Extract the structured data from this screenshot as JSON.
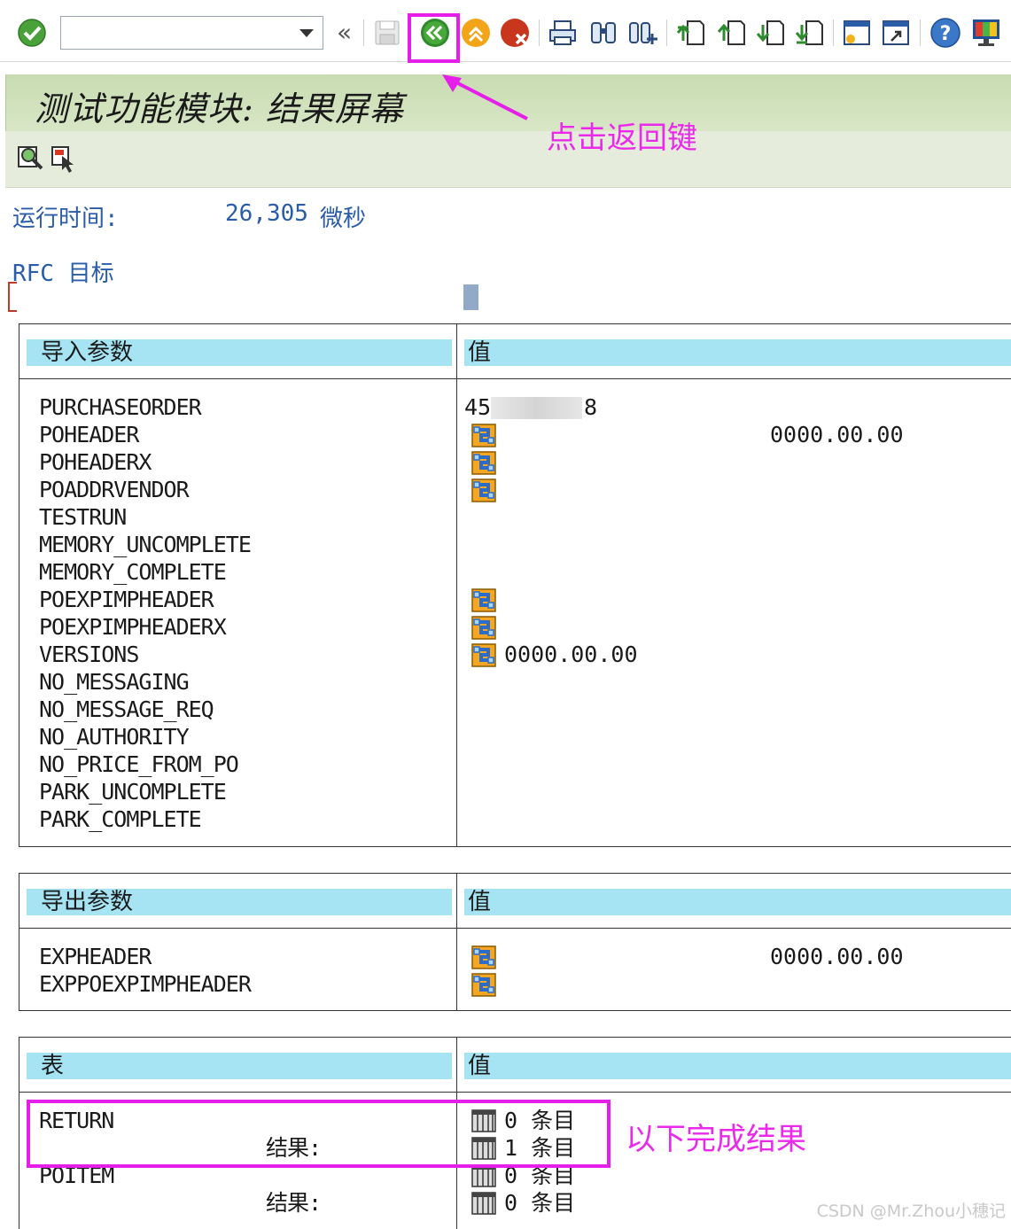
{
  "toolbar": {
    "command_value": "",
    "icons": [
      "enter-icon",
      "nav-back-chevron",
      "save-icon",
      "back-icon",
      "exit-icon",
      "cancel-icon",
      "print-icon",
      "find-icon",
      "find-next-icon",
      "first-page-icon",
      "prev-page-icon",
      "next-page-icon",
      "last-page-icon",
      "new-session-icon",
      "shortcut-icon",
      "help-icon",
      "customize-layout-icon"
    ],
    "chevron": "«"
  },
  "annotations": {
    "back_note": "点击返回键",
    "result_note": "以下完成结果",
    "color": "#e51ee9"
  },
  "screen": {
    "title": "测试功能模块: 结果屏幕",
    "runtime_label": "运行时间:",
    "runtime_value": "26,305",
    "runtime_unit": "微秒",
    "rfc_label": "RFC 目标"
  },
  "import_table": {
    "header_param": "导入参数",
    "header_value": "值",
    "rows": [
      {
        "name": "PURCHASEORDER",
        "value_prefix": "45",
        "value_suffix": "8"
      },
      {
        "name": "POHEADER",
        "icon": true,
        "right_value": "0000.00.00"
      },
      {
        "name": "POHEADERX",
        "icon": true
      },
      {
        "name": "POADDRVENDOR",
        "icon": true
      },
      {
        "name": "TESTRUN"
      },
      {
        "name": "MEMORY_UNCOMPLETE"
      },
      {
        "name": "MEMORY_COMPLETE"
      },
      {
        "name": "POEXPIMPHEADER",
        "icon": true
      },
      {
        "name": "POEXPIMPHEADERX",
        "icon": true
      },
      {
        "name": "VERSIONS",
        "icon": true,
        "value": "0000.00.00"
      },
      {
        "name": "NO_MESSAGING"
      },
      {
        "name": "NO_MESSAGE_REQ"
      },
      {
        "name": "NO_AUTHORITY"
      },
      {
        "name": "NO_PRICE_FROM_PO"
      },
      {
        "name": "PARK_UNCOMPLETE"
      },
      {
        "name": "PARK_COMPLETE"
      }
    ]
  },
  "export_table": {
    "header_param": "导出参数",
    "header_value": "值",
    "rows": [
      {
        "name": "EXPHEADER",
        "icon": true,
        "right_value": "0000.00.00"
      },
      {
        "name": "EXPPOEXPIMPHEADER",
        "icon": true
      }
    ]
  },
  "tables_table": {
    "header_param": "表",
    "header_value": "值",
    "rows": [
      {
        "name": "RETURN",
        "value": "0 条目"
      },
      {
        "name": "结果:",
        "value": "1 条目"
      },
      {
        "name": "POITEM",
        "value": "0 条目"
      },
      {
        "name": "结果:",
        "value": "0 条目"
      }
    ]
  },
  "watermark": "CSDN @Mr.Zhou小穗记"
}
